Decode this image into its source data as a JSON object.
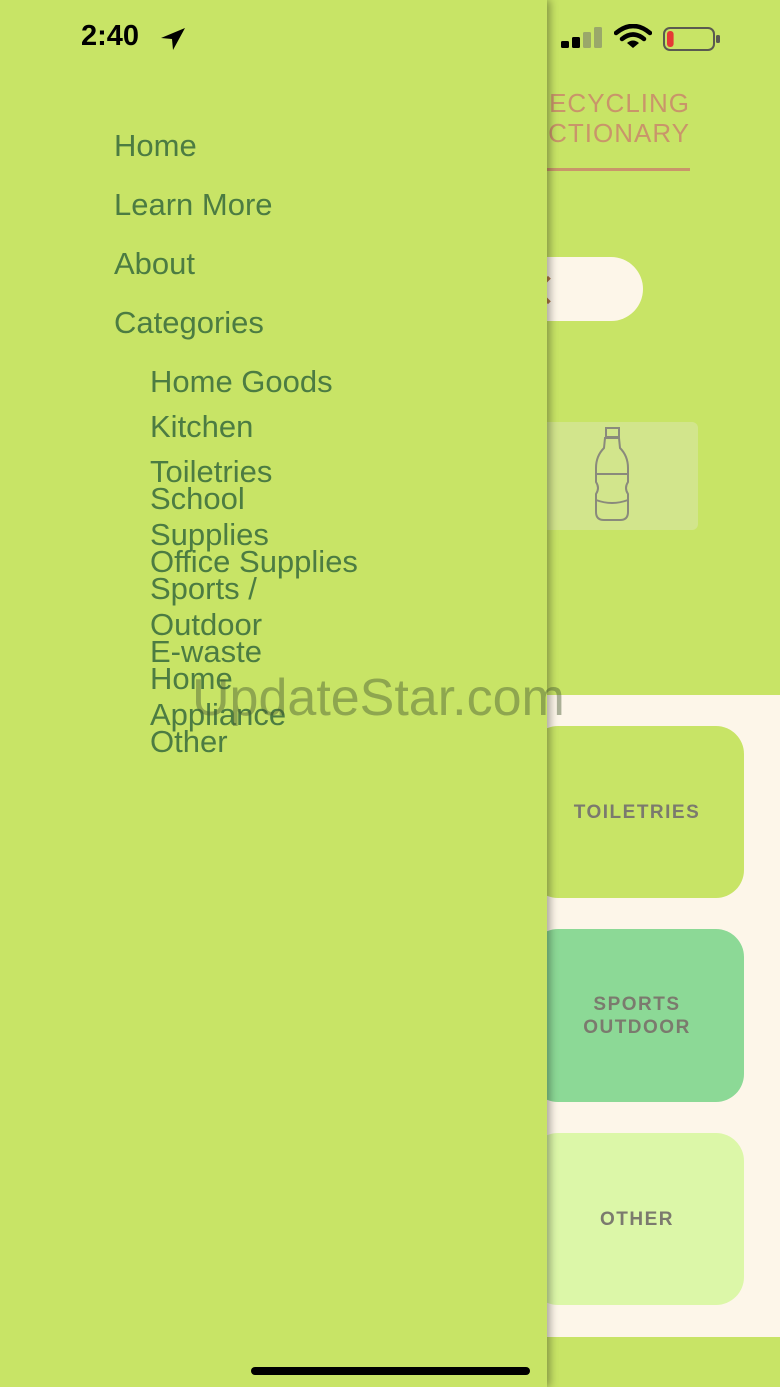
{
  "status_bar": {
    "time": "2:40",
    "battery_level": 0.15,
    "battery_color": "#e53935"
  },
  "app": {
    "title_line1": "ECYCLING",
    "title_line2": "CTIONARY",
    "categories": [
      {
        "id": "toiletries",
        "lines": [
          "TOILETRIES"
        ]
      },
      {
        "id": "sports",
        "lines": [
          "SPORTS",
          "OUTDOOR"
        ]
      },
      {
        "id": "other",
        "lines": [
          "OTHER"
        ]
      }
    ]
  },
  "drawer": {
    "nav": [
      "Home",
      "Learn More",
      "About",
      "Categories"
    ],
    "subcategories": {
      "home_goods": "Home Goods",
      "kitchen": "Kitchen",
      "toiletries": "Toiletries",
      "school_supplies_1": "School",
      "school_supplies_2": "Supplies",
      "office_supplies": "Office Supplies",
      "sports_outdoor_1": "Sports /",
      "sports_outdoor_2": "Outdoor",
      "e_waste": "E-waste",
      "home_appliance_1": "Home",
      "home_appliance_2": "Appliance",
      "other": "Other"
    }
  },
  "watermark": "UpdateStar.com",
  "colors": {
    "drawer_bg": "#c8e466",
    "nav_text": "#4c7c42",
    "accent": "#c9956a"
  }
}
